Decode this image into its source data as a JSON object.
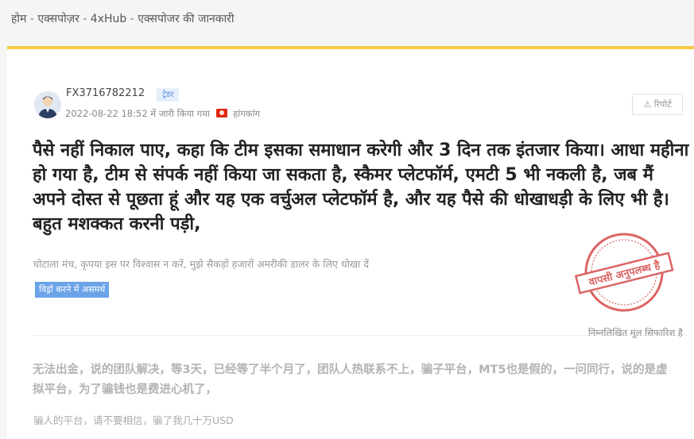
{
  "breadcrumb": {
    "items": [
      "होम",
      "एक्सपोज़र",
      "4xHub",
      "एक्सपोजर की जानकारी"
    ],
    "separator": " - "
  },
  "post": {
    "username": "FX3716782212",
    "role": "ट्रेडर",
    "datetime": "2022-08-22 18:52",
    "published_label": "में जारी किया गया",
    "region": "हांगकांग",
    "report_label": "रिपोर्ट",
    "title": "पैसे नहीं निकाल पाए, कहा कि टीम इसका समाधान करेगी और 3 दिन तक इंतजार किया। आधा महीना हो गया है, टीम से संपर्क नहीं किया जा सकता है, स्कैमर प्लेटफॉर्म, एमटी 5 भी नकली है, जब मैं अपने दोस्त से पूछता हूं और यह एक वर्चुअल प्लेटफॉर्म है, और यह पैसे की धोखाधड़ी के लिए भी है। बहुत मशक्कत करनी पड़ी,",
    "subtitle": "घोटाला मंच, कृपया इस पर विश्वास न करें, मुझे सैकड़ों हजारों अमरीकी डालर के लिए धोखा दें",
    "status_tag": "विड्रॉ करने में असमर्थ",
    "stamp_text": "वापसी अनुपलब्ध है",
    "recommend_note": "निम्नलिखित मूल सिफारिश है",
    "original_title": "无法出金，说的团队解决，等3天，已经等了半个月了，团队人热联系不上，骗子平台，MT5也是假的，一问同行，说的是虚拟平台，为了骗钱也是费进心机了，",
    "original_subtitle": "骗人的平台，请不要相信，骗了我几十万USD"
  },
  "colors": {
    "accent_bar": "#f6cc47",
    "tag_blue": "#6aa3e8",
    "stamp_red": "#d64a4a",
    "flag_red": "#de2910"
  },
  "icons": {
    "avatar": "user-avatar-icon",
    "report": "warning-triangle-icon",
    "flag": "hong-kong-flag-icon"
  }
}
